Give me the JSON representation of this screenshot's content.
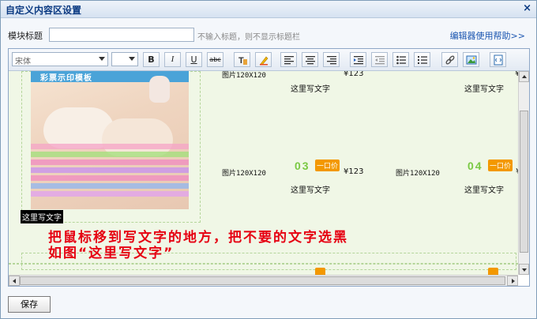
{
  "window": {
    "title": "自定义内容区设置",
    "close_glyph": "×"
  },
  "title_field": {
    "label": "模块标题",
    "value": "",
    "hint": "不输入标题，则不显示标题栏"
  },
  "help_link": "编辑器使用帮助>>",
  "toolbar": {
    "font_value": "宋体",
    "size_value": "",
    "buttons": [
      {
        "name": "bold",
        "glyph": "B"
      },
      {
        "name": "italic",
        "glyph": "I"
      },
      {
        "name": "underline",
        "glyph": "U"
      },
      {
        "name": "strikethrough",
        "glyph": "abc"
      }
    ]
  },
  "content": {
    "banner_text": "彩票示印模板",
    "row1": {
      "img_label": "图片120X120",
      "price": "¥123",
      "write_1": "这里写文字",
      "write_2": "这里写文字"
    },
    "row2": {
      "img_label_1": "图片120X120",
      "num_1": "03",
      "badge_1": "一口价",
      "price_1": "¥123",
      "img_label_2": "图片120X120",
      "num_2": "04",
      "badge_2": "一口价",
      "price_2": "¥",
      "write_1": "这里写文字",
      "write_2": "这里写文字"
    },
    "selected_text": "这里写文字",
    "instruction_1": "把鼠标移到写文字的地方，把不要的文字选黑",
    "instruction_2": "如图“这里写文字”"
  },
  "footer": {
    "save_label": "保存"
  },
  "colors": {
    "accent_green": "#7ac943",
    "badge_orange": "#f39800",
    "instruction_red": "#e60012"
  }
}
